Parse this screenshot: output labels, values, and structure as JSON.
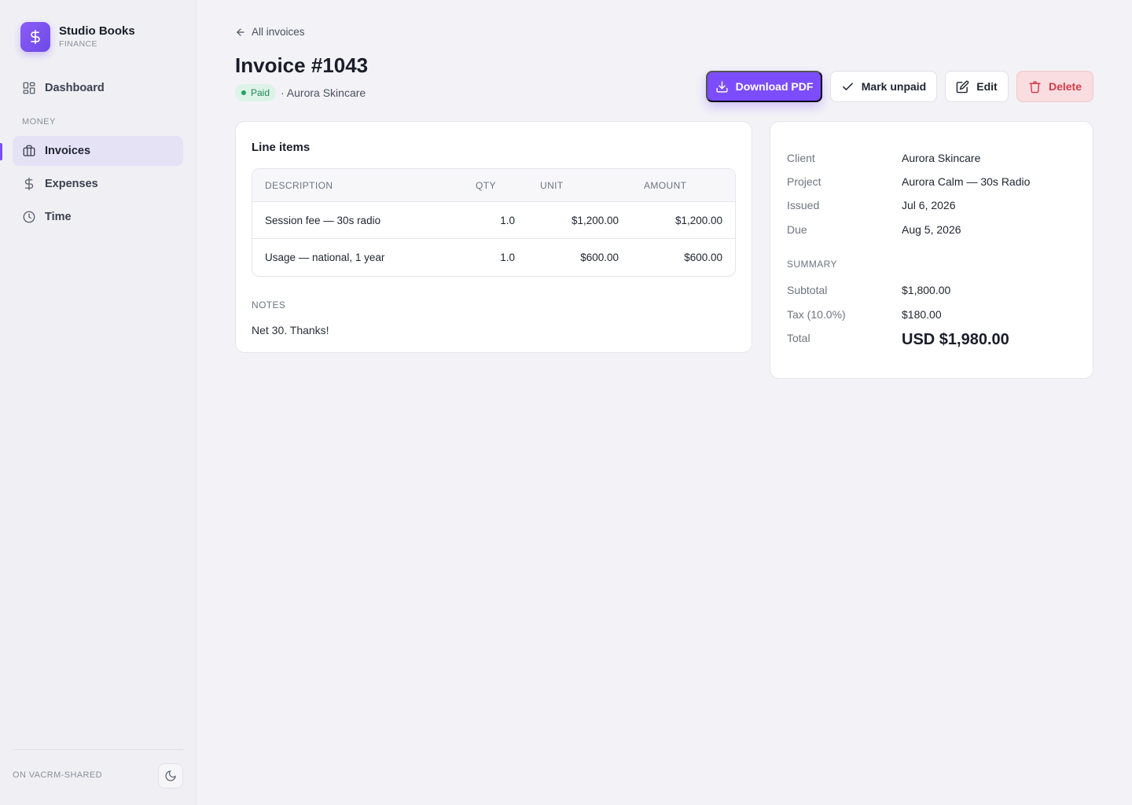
{
  "brand": {
    "name": "Studio Books",
    "subtitle": "FINANCE"
  },
  "sidebar": {
    "items": [
      {
        "label": "Dashboard",
        "icon": "dashboard-icon"
      },
      {
        "label": "Invoices",
        "icon": "briefcase-icon",
        "active": true
      },
      {
        "label": "Expenses",
        "icon": "dollar-icon"
      },
      {
        "label": "Time",
        "icon": "clock-icon"
      }
    ],
    "section_money": "MONEY",
    "footer_text": "ON VACRM-SHARED",
    "theme_icon": "moon-icon"
  },
  "header": {
    "back_label": "All invoices",
    "title": "Invoice #1043",
    "status": "Paid",
    "client_line": "· Aurora Skincare"
  },
  "actions": {
    "download": "Download PDF",
    "mark_unpaid": "Mark unpaid",
    "edit": "Edit",
    "delete": "Delete"
  },
  "line_items": {
    "title": "Line items",
    "columns": [
      "DESCRIPTION",
      "QTY",
      "UNIT",
      "AMOUNT"
    ],
    "rows": [
      {
        "description": "Session fee — 30s radio",
        "qty": "1.0",
        "unit": "$1,200.00",
        "amount": "$1,200.00"
      },
      {
        "description": "Usage — national, 1 year",
        "qty": "1.0",
        "unit": "$600.00",
        "amount": "$600.00"
      }
    ]
  },
  "notes": {
    "label": "NOTES",
    "text": "Net 30. Thanks!"
  },
  "details": {
    "client_label": "Client",
    "client": "Aurora Skincare",
    "project_label": "Project",
    "project": "Aurora Calm — 30s Radio",
    "issued_label": "Issued",
    "issued": "Jul 6, 2026",
    "due_label": "Due",
    "due": "Aug 5, 2026"
  },
  "summary": {
    "label": "SUMMARY",
    "subtotal_label": "Subtotal",
    "subtotal": "$1,800.00",
    "tax_label": "Tax (10.0%)",
    "tax": "$180.00",
    "total_label": "Total",
    "total": "USD $1,980.00"
  },
  "colors": {
    "accent": "#7c4dff",
    "paid": "#1f8a55",
    "danger": "#d43b4a"
  }
}
